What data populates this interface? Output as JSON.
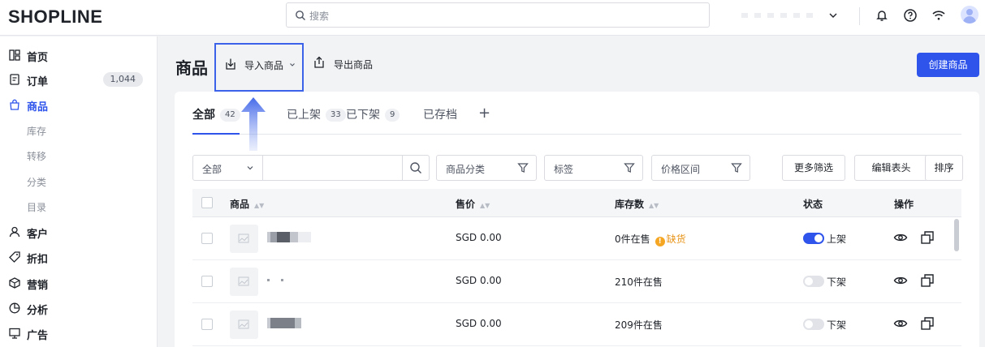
{
  "brand": {
    "logo": "SHOPLINE"
  },
  "search": {
    "placeholder": "搜索"
  },
  "sidebar": {
    "items": [
      {
        "label": "首页",
        "icon": "dashboard-icon"
      },
      {
        "label": "订单",
        "icon": "order-icon",
        "badge": "1,044"
      },
      {
        "label": "商品",
        "icon": "bag-icon",
        "active": true
      },
      {
        "label": "库存",
        "sub": true
      },
      {
        "label": "转移",
        "sub": true
      },
      {
        "label": "分类",
        "sub": true
      },
      {
        "label": "目录",
        "sub": true
      },
      {
        "label": "客户",
        "icon": "user-icon"
      },
      {
        "label": "折扣",
        "icon": "tag-icon"
      },
      {
        "label": "营销",
        "icon": "cube-icon"
      },
      {
        "label": "分析",
        "icon": "chart-icon"
      },
      {
        "label": "广告",
        "icon": "ad-icon"
      }
    ]
  },
  "header": {
    "title": "商品",
    "import_label": "导入商品",
    "export_label": "导出商品",
    "create_label": "创建商品"
  },
  "tabs": [
    {
      "label": "全部",
      "count": "42",
      "active": true
    },
    {
      "label": "已上架",
      "count": "33"
    },
    {
      "label": "已下架",
      "count": "9"
    },
    {
      "label": "已存档"
    }
  ],
  "tab_add": "+",
  "filters": {
    "scope": "全部",
    "category": "商品分类",
    "tags": "标签",
    "price": "价格区间",
    "more": "更多筛选",
    "edit_header": "编辑表头",
    "sort": "排序"
  },
  "table": {
    "columns": [
      "商品",
      "售价",
      "库存数",
      "状态",
      "操作"
    ],
    "rows": [
      {
        "price": "SGD 0.00",
        "stock": "0件在售",
        "warning": "缺货",
        "status": "上架",
        "on": true
      },
      {
        "price": "SGD 0.00",
        "stock": "210件在售",
        "status": "下架",
        "on": false
      },
      {
        "price": "SGD 0.00",
        "stock": "209件在售",
        "status": "下架",
        "on": false
      }
    ]
  },
  "colors": {
    "accent": "#2f54eb",
    "highlight_box": "#3b62e8",
    "warning": "#f5a623"
  }
}
